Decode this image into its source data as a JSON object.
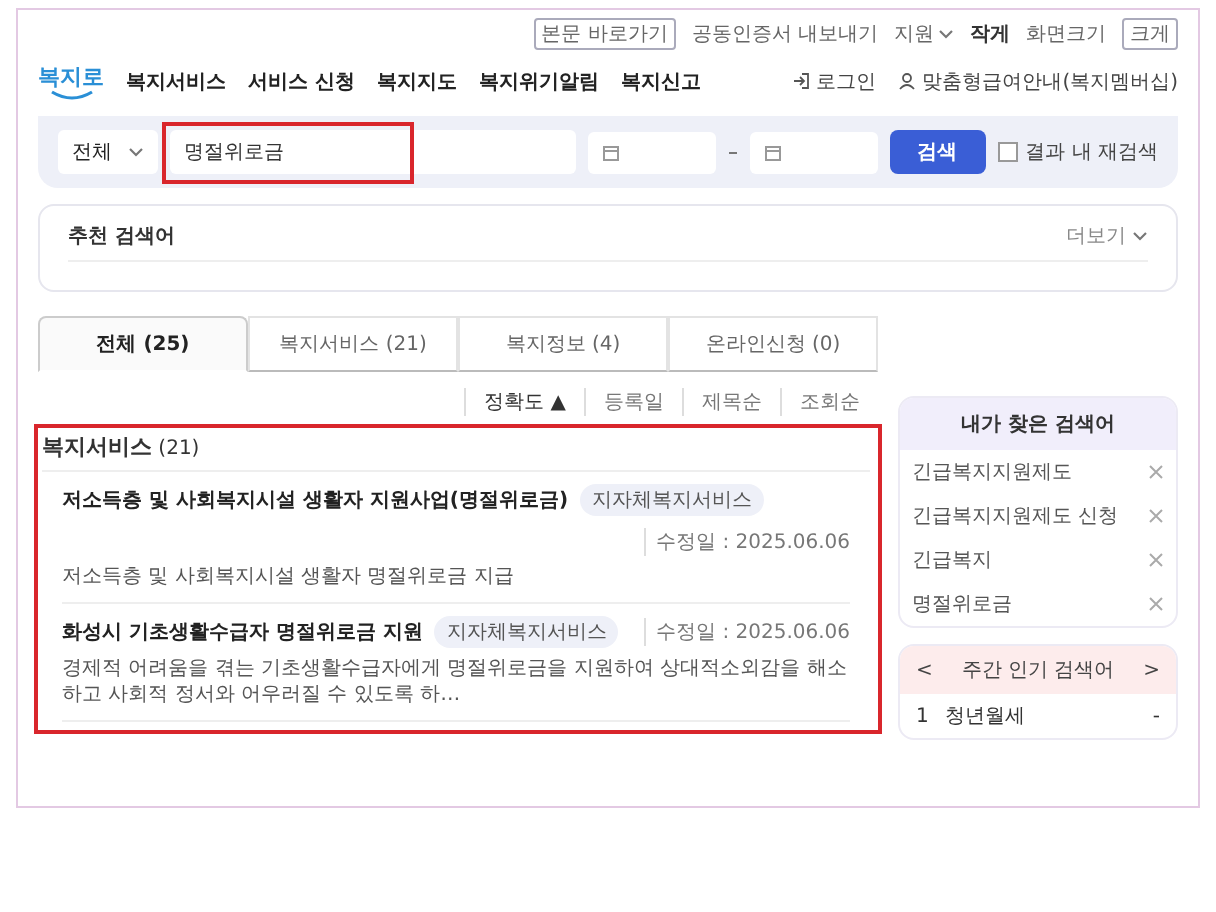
{
  "utility_links": [
    {
      "label": "본문 바로가기",
      "kind": "boxed"
    },
    {
      "label": "공동인증서 내보내기",
      "kind": "plain"
    },
    {
      "label": "지원",
      "kind": "dropdown"
    },
    {
      "label": "작게",
      "kind": "strong"
    },
    {
      "label": "화면크기",
      "kind": "plain"
    },
    {
      "label": "크게",
      "kind": "boxed"
    }
  ],
  "logo": {
    "text": "복지로"
  },
  "nav": [
    "복지서비스",
    "서비스 신청",
    "복지지도",
    "복지위기알림",
    "복지신고"
  ],
  "account": {
    "login": "로그인",
    "membership": "맞춤형급여안내(복지멤버십)"
  },
  "search": {
    "scope": "전체",
    "query": "명절위로금",
    "highlighted": true,
    "button": "검색",
    "refine": {
      "label": "결과 내 재검색",
      "checked": false
    }
  },
  "recommend": {
    "title": "추천 검색어",
    "more": "더보기"
  },
  "tabs": [
    {
      "label": "전체 (25)",
      "selected": true
    },
    {
      "label": "복지서비스 (21)",
      "selected": false
    },
    {
      "label": "복지정보 (4)",
      "selected": false
    },
    {
      "label": "온라인신청 (0)",
      "selected": false
    }
  ],
  "sort": [
    {
      "label": "정확도",
      "arrow": "▲",
      "selected": true
    },
    {
      "label": "등록일",
      "selected": false
    },
    {
      "label": "제목순",
      "selected": false
    },
    {
      "label": "조회순",
      "selected": false
    }
  ],
  "results": {
    "heading": "복지서비스",
    "count": "(21)",
    "highlighted": true,
    "items": [
      {
        "title": "저소득층 및 사회복지시설 생활자 지원사업(명절위로금)",
        "tag": "지자체복지서비스",
        "date": "수정일 : 2025.06.06",
        "summary": "저소득층 및 사회복지시설 생활자 명절위로금 지급"
      },
      {
        "title": "화성시 기초생활수급자 명절위로금 지원",
        "tag": "지자체복지서비스",
        "date": "수정일 : 2025.06.06",
        "summary": "경제적 어려움을 겪는 기초생활수급자에게 명절위로금을 지원하여 상대적소외감을 해소하고 사회적 정서와 어우러질 수 있도록 하…"
      }
    ]
  },
  "sidebar": {
    "recent": {
      "title": "내가 찾은 검색어",
      "items": [
        "긴급복지지원제도",
        "긴급복지지원제도 신청",
        "긴급복지",
        "명절위로금"
      ]
    },
    "popular": {
      "title": "주간 인기 검색어",
      "prev": "<",
      "next": ">",
      "items": [
        {
          "rank": "1",
          "term": "청년월세",
          "change": "-"
        }
      ]
    }
  }
}
